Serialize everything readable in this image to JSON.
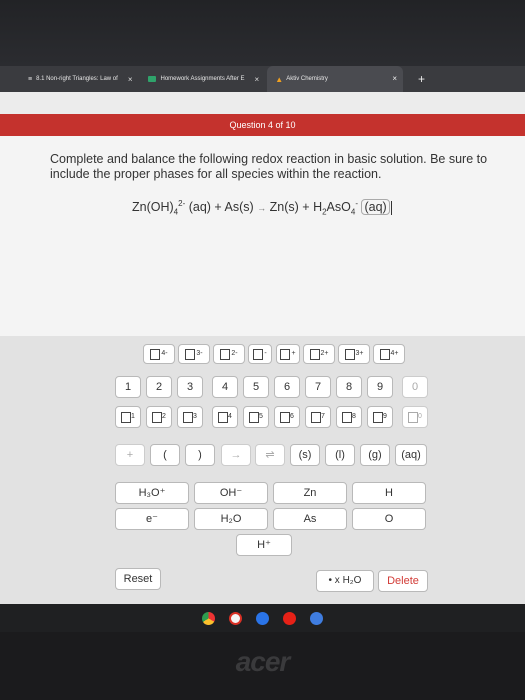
{
  "tabs": [
    {
      "label": "8.1 Non-right Triangles: Law of",
      "close": "×",
      "icon": "list-icon"
    },
    {
      "label": "Homework Assignments After E",
      "close": "×",
      "icon": "classroom-icon"
    },
    {
      "label": "Aktiv Chemistry",
      "close": "×",
      "icon": "aktiv-icon"
    }
  ],
  "window_close": "×",
  "new_tab": "+",
  "header": {
    "title": "Question 4 of 10"
  },
  "question": {
    "prompt": "Complete and balance the following redox reaction in basic solution. Be sure to include the proper phases for all species within the reaction.",
    "reaction_lhs1": "Zn(OH)",
    "lhs1_sub": "4",
    "lhs1_sup": "2-",
    "lhs1_phase": "(aq) + As(s)",
    "arrow": "→",
    "rhs1": "Zn(s) + H",
    "rhs_sub1": "2",
    "rhs2": "AsO",
    "rhs_sub2": "4",
    "rhs_sup": "-",
    "rhs_answer": "(aq)"
  },
  "charges": [
    "4-",
    "3-",
    "2-",
    "-",
    "+",
    "2+",
    "3+",
    "4+"
  ],
  "digits": [
    "1",
    "2",
    "3",
    "4",
    "5",
    "6",
    "7",
    "8",
    "9",
    "0"
  ],
  "subscripts": [
    "1",
    "2",
    "3",
    "4",
    "5",
    "6",
    "7",
    "8",
    "9",
    "0"
  ],
  "symbols": [
    "+",
    "(",
    ")",
    "→",
    "⇌",
    "(s)",
    "(l)",
    "(g)",
    "(aq)"
  ],
  "species": [
    {
      "label": "H₃O⁺"
    },
    {
      "label": "OH⁻"
    },
    {
      "label": "Zn"
    },
    {
      "label": "H"
    },
    {
      "label": "e⁻"
    },
    {
      "label": "H₂O"
    },
    {
      "label": "As"
    },
    {
      "label": "O"
    },
    {
      "label": "H⁺"
    }
  ],
  "actions": {
    "reset": "Reset",
    "water": "• x H₂O",
    "delete": "Delete"
  },
  "brand": "acer"
}
